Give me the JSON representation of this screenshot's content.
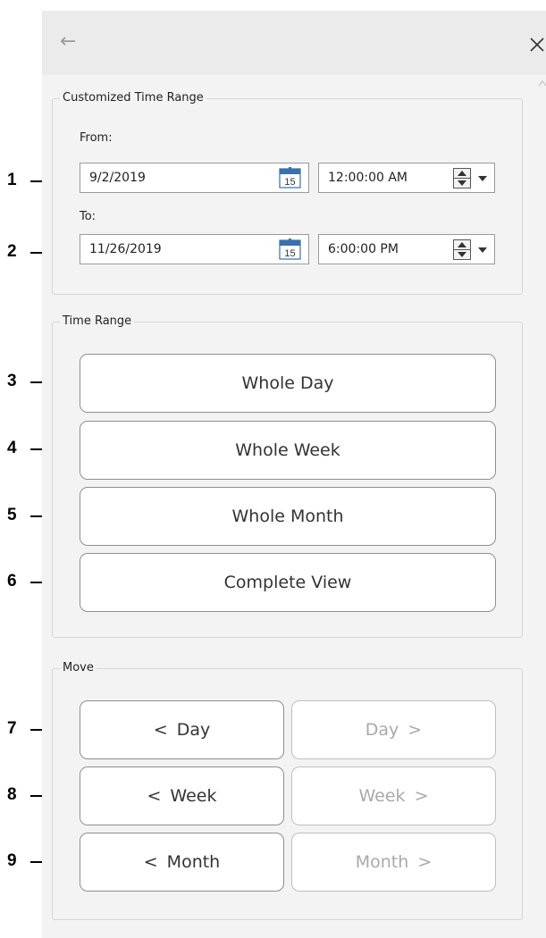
{
  "header": {
    "back_icon": "←",
    "close_icon": "close-icon"
  },
  "customized": {
    "legend": "Customized Time Range",
    "from_label": "From:",
    "to_label": "To:",
    "from_date": "9/2/2019",
    "from_time": "12:00:00 AM",
    "to_date": "11/26/2019",
    "to_time": "6:00:00 PM",
    "calendar_day": "15"
  },
  "time_range": {
    "legend": "Time Range",
    "buttons": [
      "Whole Day",
      "Whole Week",
      "Whole Month",
      "Complete View"
    ]
  },
  "move": {
    "legend": "Move",
    "prev": [
      "Day",
      "Week",
      "Month"
    ],
    "next": [
      "Day",
      "Week",
      "Month"
    ],
    "prev_glyph": "<",
    "next_glyph": ">"
  },
  "callouts": [
    "1",
    "2",
    "3",
    "4",
    "5",
    "6",
    "7",
    "8",
    "9"
  ]
}
